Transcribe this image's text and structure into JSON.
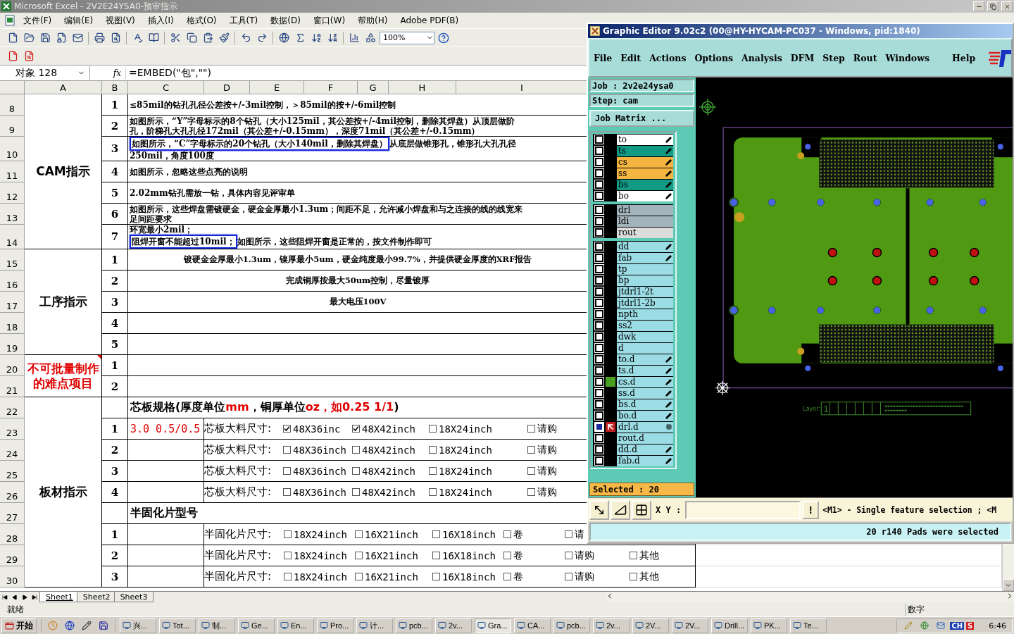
{
  "excel": {
    "title": "Microsoft Excel - 2V2E24YSA0-预审指示",
    "menu": [
      "文件(F)",
      "编辑(E)",
      "视图(V)",
      "插入(I)",
      "格式(O)",
      "工具(T)",
      "数据(D)",
      "窗口(W)",
      "帮助(H)",
      "Adobe PDF(B)"
    ],
    "zoom": "100%",
    "name_box": "对象 128",
    "function_label": "fx",
    "formula": "=EMBED(\"包\",\"\")",
    "columns": [
      "A",
      "B",
      "C",
      "D",
      "E",
      "F",
      "G",
      "H",
      "I"
    ],
    "sections": [
      {
        "label": "CAM指示",
        "red": false,
        "comment": false,
        "rows": [
          {
            "number": "8",
            "index": "1",
            "kind": "text",
            "lines": [
              [
                {
                  "text": "≤85mil的钻孔孔径公差按+/-3mil控制，＞85mil的按+/-6mil控制",
                  "boxed": false
                }
              ]
            ]
          },
          {
            "number": "9",
            "index": "2",
            "kind": "text",
            "lines": [
              [
                {
                  "text": "如图所示，“Y”字母标示的8个钻孔（大小125mil，其公差按+/-4mil控制，删除其焊盘）从顶层做阶",
                  "boxed": false
                }
              ],
              [
                {
                  "text": "孔，阶梯孔大孔孔径172mil（其公差+/-0.15mm），深度71mil（其公差+/-0.15mm）",
                  "boxed": false
                }
              ]
            ]
          },
          {
            "number": "10",
            "index": "3",
            "kind": "text",
            "lines": [
              [
                {
                  "text": "如图所示，“C”字母标示的20个钻孔（大小140mil，删除其焊盘）",
                  "boxed": true
                },
                {
                  "text": "从底层做锥形孔，锥形孔大孔孔径",
                  "boxed": false
                }
              ],
              [
                {
                  "text": "250mil，角度100度",
                  "boxed": false
                }
              ]
            ]
          },
          {
            "number": "11",
            "index": "4",
            "kind": "text",
            "lines": [
              [
                {
                  "text": "如图所示，忽略这些点亮的说明",
                  "boxed": false
                }
              ]
            ]
          },
          {
            "number": "12",
            "index": "5",
            "kind": "text",
            "lines": [
              [
                {
                  "text": "2.02mm钻孔需放一钻，具体内容见评审单",
                  "boxed": false
                }
              ]
            ]
          },
          {
            "number": "13",
            "index": "6",
            "kind": "text",
            "lines": [
              [
                {
                  "text": "如图所示，这些焊盘需镀硬金，硬金金厚最小1.3um；间距不足，允许减小焊盘和与之连接的线的线宽来",
                  "boxed": false
                }
              ],
              [
                {
                  "text": "足间距要求",
                  "boxed": false
                }
              ]
            ]
          },
          {
            "number": "14",
            "index": "7",
            "kind": "text",
            "lines": [
              [
                {
                  "text": "环宽最小2mil；",
                  "boxed": false
                }
              ],
              [
                {
                  "text": "阻焊开窗不能超过10mil；",
                  "boxed": true
                },
                {
                  "text": "如图所示，这些阻焊开窗是正常的，按文件制作即可",
                  "boxed": false
                }
              ]
            ]
          }
        ]
      },
      {
        "label": "工序指示",
        "red": false,
        "comment": false,
        "rows": [
          {
            "number": "15",
            "index": "1",
            "kind": "center",
            "text": "镀硬金金厚最小1.3um，镍厚最小5um，硬金纯度最小99.7%，并提供硬金厚度的XRF报告"
          },
          {
            "number": "16",
            "index": "2",
            "kind": "center",
            "text": "完成铜厚按最大50um控制，尽量镀厚"
          },
          {
            "number": "17",
            "index": "3",
            "kind": "center",
            "text": "最大电压100V"
          },
          {
            "number": "18",
            "index": "4",
            "kind": "empty"
          },
          {
            "number": "19",
            "index": "5",
            "kind": "empty"
          }
        ]
      },
      {
        "label": "不可批量制作的难点项目",
        "red": true,
        "comment": true,
        "rows": [
          {
            "number": "20",
            "index": "1",
            "kind": "empty"
          },
          {
            "number": "21",
            "index": "2",
            "kind": "empty"
          }
        ]
      },
      {
        "label": "板材指示",
        "red": false,
        "comment": false,
        "rows": [
          {
            "number": "22",
            "kind": "header",
            "segments": [
              {
                "text": "芯板规格(厚度单位",
                "red": false
              },
              {
                "text": "mm",
                "red": true
              },
              {
                "text": "，铜厚单位",
                "red": false
              },
              {
                "text": "oz，如0.25 1/1",
                "red": true
              },
              {
                "text": ")",
                "red": false
              }
            ]
          },
          {
            "number": "23",
            "index": "1",
            "kind": "core",
            "value": {
              "text": "3.0 0.5/0.5",
              "red": true
            },
            "label": "芯板大料尺寸:",
            "options": [
              {
                "label": "48X36inc",
                "checked": true
              },
              {
                "label": "48X42inch",
                "checked": true
              },
              {
                "label": "18X24inch",
                "checked": false
              },
              {
                "label": "请购",
                "checked": false
              }
            ]
          },
          {
            "number": "24",
            "index": "2",
            "kind": "core",
            "label": "芯板大料尺寸:",
            "options": [
              {
                "label": "48X36inch",
                "checked": false
              },
              {
                "label": "48X42inch",
                "checked": false
              },
              {
                "label": "18X24inch",
                "checked": false
              },
              {
                "label": "请购",
                "checked": false
              }
            ]
          },
          {
            "number": "25",
            "index": "3",
            "kind": "core",
            "label": "芯板大料尺寸:",
            "options": [
              {
                "label": "48X36inch",
                "checked": false
              },
              {
                "label": "48X42inch",
                "checked": false
              },
              {
                "label": "18X24inch",
                "checked": false
              },
              {
                "label": "请购",
                "checked": false
              }
            ]
          },
          {
            "number": "26",
            "index": "4",
            "kind": "core",
            "label": "芯板大料尺寸:",
            "options": [
              {
                "label": "48X36inch",
                "checked": false
              },
              {
                "label": "48X42inch",
                "checked": false
              },
              {
                "label": "18X24inch",
                "checked": false
              },
              {
                "label": "请购",
                "checked": false
              }
            ]
          },
          {
            "number": "27",
            "kind": "header",
            "segments": [
              {
                "text": "半固化片型号",
                "red": false
              }
            ]
          },
          {
            "number": "28",
            "index": "1",
            "kind": "prepreg",
            "label": "半固化片尺寸:",
            "options": [
              {
                "label": "18X24inch",
                "checked": false
              },
              {
                "label": "16X21inch",
                "checked": false
              },
              {
                "label": "16X18inch",
                "checked": false
              },
              {
                "label": "卷",
                "checked": false
              },
              {
                "label": "请",
                "checked": false
              }
            ]
          },
          {
            "number": "29",
            "index": "2",
            "kind": "prepreg",
            "label": "半固化片尺寸:",
            "options": [
              {
                "label": "18X24inch",
                "checked": false
              },
              {
                "label": "16X21inch",
                "checked": false
              },
              {
                "label": "16X18inch",
                "checked": false
              },
              {
                "label": "卷",
                "checked": false
              },
              {
                "label": "请购",
                "checked": false
              },
              {
                "label": "其他",
                "checked": false
              }
            ]
          },
          {
            "number": "30",
            "index": "3",
            "kind": "prepreg",
            "label": "半固化片尺寸:",
            "options": [
              {
                "label": "18X24inch",
                "checked": false
              },
              {
                "label": "16X21inch",
                "checked": false
              },
              {
                "label": "16X18inch",
                "checked": false
              },
              {
                "label": "卷",
                "checked": false
              },
              {
                "label": "请购",
                "checked": false
              },
              {
                "label": "其他",
                "checked": false
              }
            ]
          }
        ]
      }
    ],
    "sheets": [
      {
        "label": "Sheet1",
        "selected": true
      },
      {
        "label": "Sheet2",
        "selected": false
      },
      {
        "label": "Sheet3",
        "selected": false
      }
    ],
    "status": "就绪",
    "mode": "数字"
  },
  "graphic_editor": {
    "title": "Graphic Editor 9.02c2 (00@HY-HYCAM-PC037 - Windows, pid:1840)",
    "menu": [
      "File",
      "Edit",
      "Actions",
      "Options",
      "Analysis",
      "DFM",
      "Step",
      "Rout",
      "Windows",
      "Help"
    ],
    "job": "Job : 2v2e24ysa0",
    "step": "Step: cam",
    "matrix_button": "Job Matrix ...",
    "layer_groups": [
      [
        {
          "name": "to",
          "color": "#ffffff",
          "kind": "pen",
          "displayed": false,
          "work_layer": false
        },
        {
          "name": "ts",
          "color": "#129a84",
          "kind": "pen",
          "displayed": false,
          "work_layer": false
        },
        {
          "name": "cs",
          "color": "#f4b640",
          "kind": "pen",
          "displayed": false,
          "work_layer": false
        },
        {
          "name": "ss",
          "color": "#f4b640",
          "kind": "pen",
          "displayed": false,
          "work_layer": false
        },
        {
          "name": "bs",
          "color": "#129a84",
          "kind": "pen",
          "displayed": false,
          "work_layer": false
        },
        {
          "name": "bo",
          "color": "#ffffff",
          "kind": "pen",
          "displayed": false,
          "work_layer": false
        }
      ],
      [
        {
          "name": "drl",
          "color": "#a4b4bc",
          "kind": "plain",
          "displayed": false,
          "work_layer": false
        },
        {
          "name": "ldi",
          "color": "#a4b4bc",
          "kind": "plain",
          "displayed": false,
          "work_layer": false
        },
        {
          "name": "rout",
          "color": "#dcdcdc",
          "kind": "plain",
          "displayed": false,
          "work_layer": false
        }
      ],
      [
        {
          "name": "dd",
          "color": "#9cdce4",
          "kind": "pen",
          "displayed": false,
          "work_layer": false
        },
        {
          "name": "fab",
          "color": "#9cdce4",
          "kind": "pen",
          "displayed": false,
          "work_layer": false
        },
        {
          "name": "tp",
          "color": "#9cdce4",
          "kind": "plain",
          "displayed": false,
          "work_layer": false
        },
        {
          "name": "bp",
          "color": "#9cdce4",
          "kind": "plain",
          "displayed": false,
          "work_layer": false
        },
        {
          "name": "jtdrl1-2t",
          "color": "#9cdce4",
          "kind": "plain",
          "displayed": false,
          "work_layer": false
        },
        {
          "name": "jtdrl1-2b",
          "color": "#9cdce4",
          "kind": "plain",
          "displayed": false,
          "work_layer": false
        },
        {
          "name": "npth",
          "color": "#9cdce4",
          "kind": "plain",
          "displayed": false,
          "work_layer": false
        },
        {
          "name": "ss2",
          "color": "#9cdce4",
          "kind": "plain",
          "displayed": false,
          "work_layer": false
        },
        {
          "name": "dwk",
          "color": "#9cdce4",
          "kind": "plain",
          "displayed": false,
          "work_layer": false
        },
        {
          "name": "d",
          "color": "#9cdce4",
          "kind": "plain",
          "displayed": false,
          "work_layer": false
        },
        {
          "name": "to.d",
          "color": "#9cdce4",
          "kind": "pen",
          "displayed": false,
          "work_layer": false
        },
        {
          "name": "ts.d",
          "color": "#9cdce4",
          "kind": "pen",
          "displayed": false,
          "work_layer": false
        },
        {
          "name": "cs.d",
          "color": "#9cdce4",
          "kind": "pen",
          "displayed": true,
          "work_layer": false
        },
        {
          "name": "ss.d",
          "color": "#9cdce4",
          "kind": "pen",
          "displayed": false,
          "work_layer": false
        },
        {
          "name": "bs.d",
          "color": "#9cdce4",
          "kind": "pen",
          "displayed": false,
          "work_layer": false
        },
        {
          "name": "bo.d",
          "color": "#9cdce4",
          "kind": "pen",
          "displayed": false,
          "work_layer": false
        },
        {
          "name": "drl.d",
          "color": "#9cdce4",
          "kind": "grid",
          "displayed": false,
          "work_layer": true
        },
        {
          "name": "rout.d",
          "color": "#9cdce4",
          "kind": "plain",
          "displayed": false,
          "work_layer": false
        },
        {
          "name": "dd.d",
          "color": "#9cdce4",
          "kind": "pen",
          "displayed": false,
          "work_layer": false
        },
        {
          "name": "fab.d",
          "color": "#9cdce4",
          "kind": "pen",
          "displayed": false,
          "work_layer": false
        }
      ]
    ],
    "selected": "Selected : 20",
    "canvas": {
      "layer_label": "Layer:",
      "sheet_number": "1"
    },
    "coord_label": "X Y :",
    "alert_button": "!",
    "prompt": "<M1> - Single feature selection ; <M",
    "status": "20 r140 Pads were selected"
  },
  "taskbar": {
    "start": "开始",
    "tasks": [
      {
        "label": "兴...",
        "selected": false
      },
      {
        "label": "Tot...",
        "selected": false
      },
      {
        "label": "制...",
        "selected": false
      },
      {
        "label": "Ge...",
        "selected": false
      },
      {
        "label": "En...",
        "selected": false
      },
      {
        "label": "Pro...",
        "selected": false
      },
      {
        "label": "计...",
        "selected": false
      },
      {
        "label": "pcb...",
        "selected": false
      },
      {
        "label": "2v...",
        "selected": false
      },
      {
        "label": "Gra...",
        "selected": true
      },
      {
        "label": "CA...",
        "selected": false
      },
      {
        "label": "pcb...",
        "selected": false
      },
      {
        "label": "2v...",
        "selected": false
      },
      {
        "label": "2V...",
        "selected": false
      },
      {
        "label": "2V...",
        "selected": false
      },
      {
        "label": "Drill...",
        "selected": false
      },
      {
        "label": "PK...",
        "selected": false
      },
      {
        "label": "Te...",
        "selected": false
      }
    ],
    "language": "CH",
    "ime": "S",
    "clock": "6:46"
  }
}
